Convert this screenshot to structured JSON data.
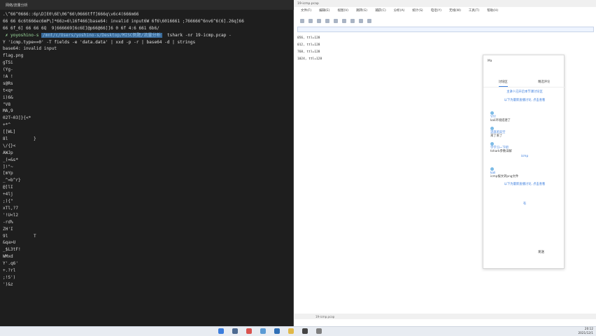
{
  "terminal": {
    "title": "网络/流量分析",
    "lines": [
      ".\\^66^0666::6p\\D]E0\\6E\\06^66\\0666tff]666q\\v6c4(666m66",
      "66 66 6c6t666ec6mP\\]*66z=6\\16f466]base64: invalid input6W 6f6\\6016661 ;766666^6nv6^6(6].26q]66",
      "66 6f_6] 66 66 6Q  9|666669]6c6E]@p66@66]]6 0 6f 4:6 661 6b6/",
      "",
      "base64: invalid input",
      "flag.png",
      "gTSi",
      "(Yg-",
      "!A !",
      "s@Rs",
      "t<q+",
      "i)6&",
      "\"V8",
      "MA,9",
      "02T~03]}{<*",
      "+*^",
      "[[WL]",
      "8l          }",
      "\\/{}<",
      "AWJp",
      "_(=&s*",
      "]!\"~",
      "[mYp",
      "_^=b^r}",
      "@]lI",
      "+4lj",
      ";){\"",
      "xTl,?7",
      "'!U<l2",
      "-rd%",
      "ZH'I",
      "9l          T",
      "&qa>U",
      "_$L3tF!",
      "WMxd",
      "Y'.q6'",
      "+.?rl",
      ";!S')",
      "')&z"
    ],
    "prompt": {
      "user": "yoyoshino-s",
      "path": "/mnt/c/Users/yoshino-s/Desktop/MISC例题/流量分析",
      "command": "tshark -nr 19-icmp.pcap -",
      "command2": "Y 'icmp.type==0' -T fields -e 'data.data' | xxd -p -r | base64 -d | strings"
    }
  },
  "wireshark": {
    "title": "19-icmp.pcap",
    "menu": [
      "文件(F)",
      "编辑(E)",
      "视图(V)",
      "跳转(G)",
      "捕获(C)",
      "分析(A)",
      "统计(S)",
      "电话(Y)",
      "无线(W)",
      "工具(T)",
      "帮助(H)"
    ],
    "packets": [
      "056, ttl=128",
      "012, ttl=128",
      "768, ttl=128",
      "1024, ttl=128"
    ],
    "status": "19-icmp.pcap"
  },
  "chat": {
    "header": "Ma",
    "tabs": [
      "讨论区",
      "精选评论"
    ],
    "messages": [
      {
        "user": "",
        "text": "主讲人已开启本节课讨论区"
      },
      {
        "user": "",
        "text": "以下为最新直播讨论, 点击查看"
      },
      {
        "user": "YYY",
        "text": "kali环境搭建了"
      },
      {
        "user": "流浪的天空",
        "text": "来了来了"
      },
      {
        "user": "学学习一下吧",
        "text": "tshark参数详解"
      },
      {
        "user": "",
        "text": "icmp"
      },
      {
        "user": "kali",
        "text": "icmp报文转png文件"
      },
      {
        "user": "",
        "text": "以下为最新直播讨论, 点击查看"
      },
      {
        "user": "",
        "text": "有"
      }
    ],
    "footer": "发送",
    "colors": {
      "accent": "#3b7ddd"
    }
  },
  "taskbar": {
    "time": "20:12",
    "date": "2021/12/1"
  }
}
